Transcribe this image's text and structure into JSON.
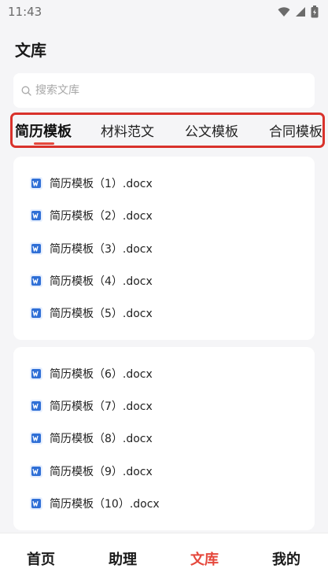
{
  "status_bar": {
    "time": "11:43"
  },
  "page": {
    "title": "文库"
  },
  "search": {
    "placeholder": "搜索文库"
  },
  "tabs": [
    {
      "label": "简历模板",
      "active": true
    },
    {
      "label": "材料范文",
      "active": false
    },
    {
      "label": "公文模板",
      "active": false
    },
    {
      "label": "合同模板",
      "active": false
    }
  ],
  "file_groups": [
    {
      "files": [
        "简历模板（1）.docx",
        "简历模板（2）.docx",
        "简历模板（3）.docx",
        "简历模板（4）.docx",
        "简历模板（5）.docx"
      ]
    },
    {
      "files": [
        "简历模板（6）.docx",
        "简历模板（7）.docx",
        "简历模板（8）.docx",
        "简历模板（9）.docx",
        "简历模板（10）.docx"
      ]
    }
  ],
  "bottom_nav": [
    {
      "label": "首页",
      "active": false
    },
    {
      "label": "助理",
      "active": false
    },
    {
      "label": "文库",
      "active": true
    },
    {
      "label": "我的",
      "active": false
    }
  ],
  "colors": {
    "accent": "#e5483c",
    "highlight_border": "#d9322b",
    "word_icon": "#2f6fd6"
  }
}
